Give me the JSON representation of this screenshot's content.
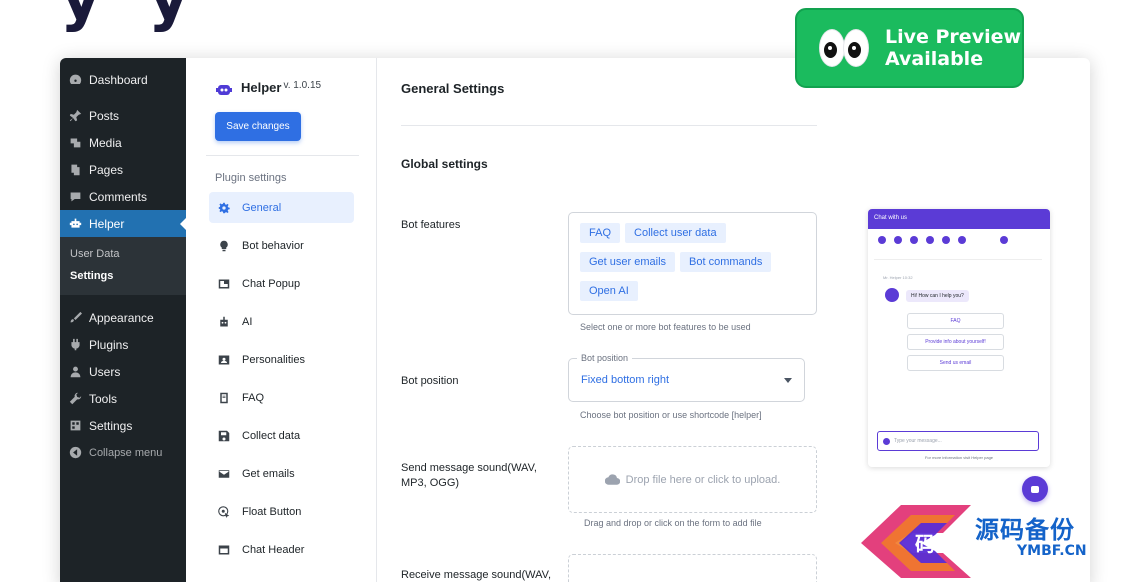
{
  "hero_fragment": "y y",
  "wp_menu": {
    "items": [
      {
        "label": "Dashboard",
        "icon": "dashboard-icon"
      },
      {
        "label": "Posts",
        "icon": "pin-icon"
      },
      {
        "label": "Media",
        "icon": "media-icon"
      },
      {
        "label": "Pages",
        "icon": "pages-icon"
      },
      {
        "label": "Comments",
        "icon": "comments-icon"
      },
      {
        "label": "Helper",
        "icon": "robot-icon"
      }
    ],
    "submenu": [
      "User Data",
      "Settings"
    ],
    "items_after": [
      {
        "label": "Appearance",
        "icon": "brush-icon"
      },
      {
        "label": "Plugins",
        "icon": "plugin-icon"
      },
      {
        "label": "Users",
        "icon": "users-icon"
      },
      {
        "label": "Tools",
        "icon": "wrench-icon"
      },
      {
        "label": "Settings",
        "icon": "settings-icon"
      }
    ],
    "collapse_label": "Collapse menu",
    "active_color": "#2271b1"
  },
  "plugin": {
    "name": "Helper",
    "version": "v. 1.0.15",
    "save_label": "Save changes",
    "section_label": "Plugin settings",
    "nav": [
      {
        "label": "General",
        "icon": "gear-icon",
        "active": true
      },
      {
        "label": "Bot behavior",
        "icon": "lightbulb-icon"
      },
      {
        "label": "Chat Popup",
        "icon": "popup-icon"
      },
      {
        "label": "AI",
        "icon": "robot-icon"
      },
      {
        "label": "Personalities",
        "icon": "id-card-icon"
      },
      {
        "label": "FAQ",
        "icon": "book-icon"
      },
      {
        "label": "Collect data",
        "icon": "save-icon"
      },
      {
        "label": "Get emails",
        "icon": "mail-icon"
      },
      {
        "label": "Float Button",
        "icon": "touch-icon"
      },
      {
        "label": "Chat Header",
        "icon": "window-icon"
      }
    ],
    "accent": "#2f6fe3"
  },
  "main": {
    "title": "General Settings",
    "section": "Global settings",
    "bot_features": {
      "label": "Bot features",
      "chips": [
        [
          "FAQ",
          "Collect user data"
        ],
        [
          "Get user emails",
          "Bot commands"
        ],
        [
          "Open AI"
        ]
      ],
      "helper": "Select one or more bot features to be used"
    },
    "bot_position": {
      "label": "Bot position",
      "legend": "Bot position",
      "value": "Fixed bottom right",
      "helper": "Choose bot position or use shortcode [helper]"
    },
    "send_sound": {
      "label": "Send message sound(WAV, MP3, OGG)",
      "drop_text": "Drop file here or click to upload.",
      "helper": "Drag and drop or click on the form to add file"
    },
    "receive_sound": {
      "label": "Receive message sound(WAV,"
    }
  },
  "preview": {
    "header": "Chat with us",
    "meta": "Mr. Helper 10:32",
    "greeting": "Hi! How can I help you?",
    "options": [
      "FAQ",
      "Provide info about yourself!",
      "Send us email"
    ],
    "input_placeholder": "Type your message...",
    "footer": "For more information visit Helper page",
    "accent": "#5b3bd6"
  },
  "live_badge": {
    "line1": "Live Preview",
    "line2": "Available",
    "color": "#1bbb5e"
  },
  "watermark": {
    "text": "源码备份",
    "sub": "YMBF.CN",
    "logo_char": "码"
  }
}
